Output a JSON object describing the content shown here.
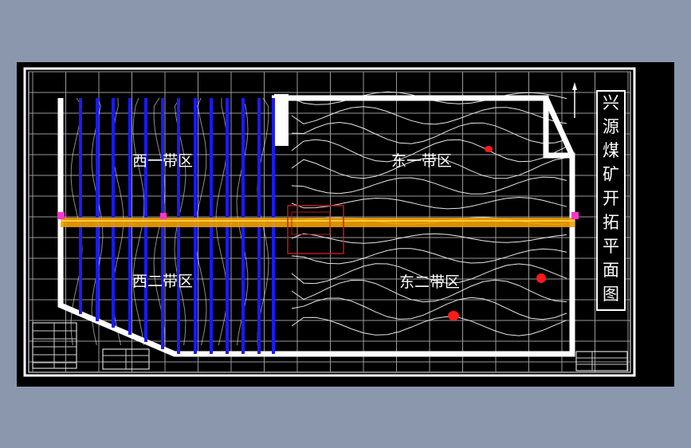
{
  "title_chars": [
    "兴",
    "源",
    "煤",
    "矿",
    "开",
    "拓",
    "平",
    "面",
    "图"
  ],
  "zones": {
    "west_one": "西一带区",
    "west_two": "西二带区",
    "east_one": "东一带区",
    "east_two": "东二带区"
  },
  "colors": {
    "background": "#8a97ad",
    "drawing_bg": "#000000",
    "frame": "#ffffff",
    "grid": "#9a9a9a",
    "contour": "#e8e8e8",
    "workface": "#1a1aff",
    "main_roadway": "#f2a000",
    "shaft_marker": "#ff33cc",
    "hazard": "#ff1a1a",
    "detail_box": "#c01818"
  }
}
